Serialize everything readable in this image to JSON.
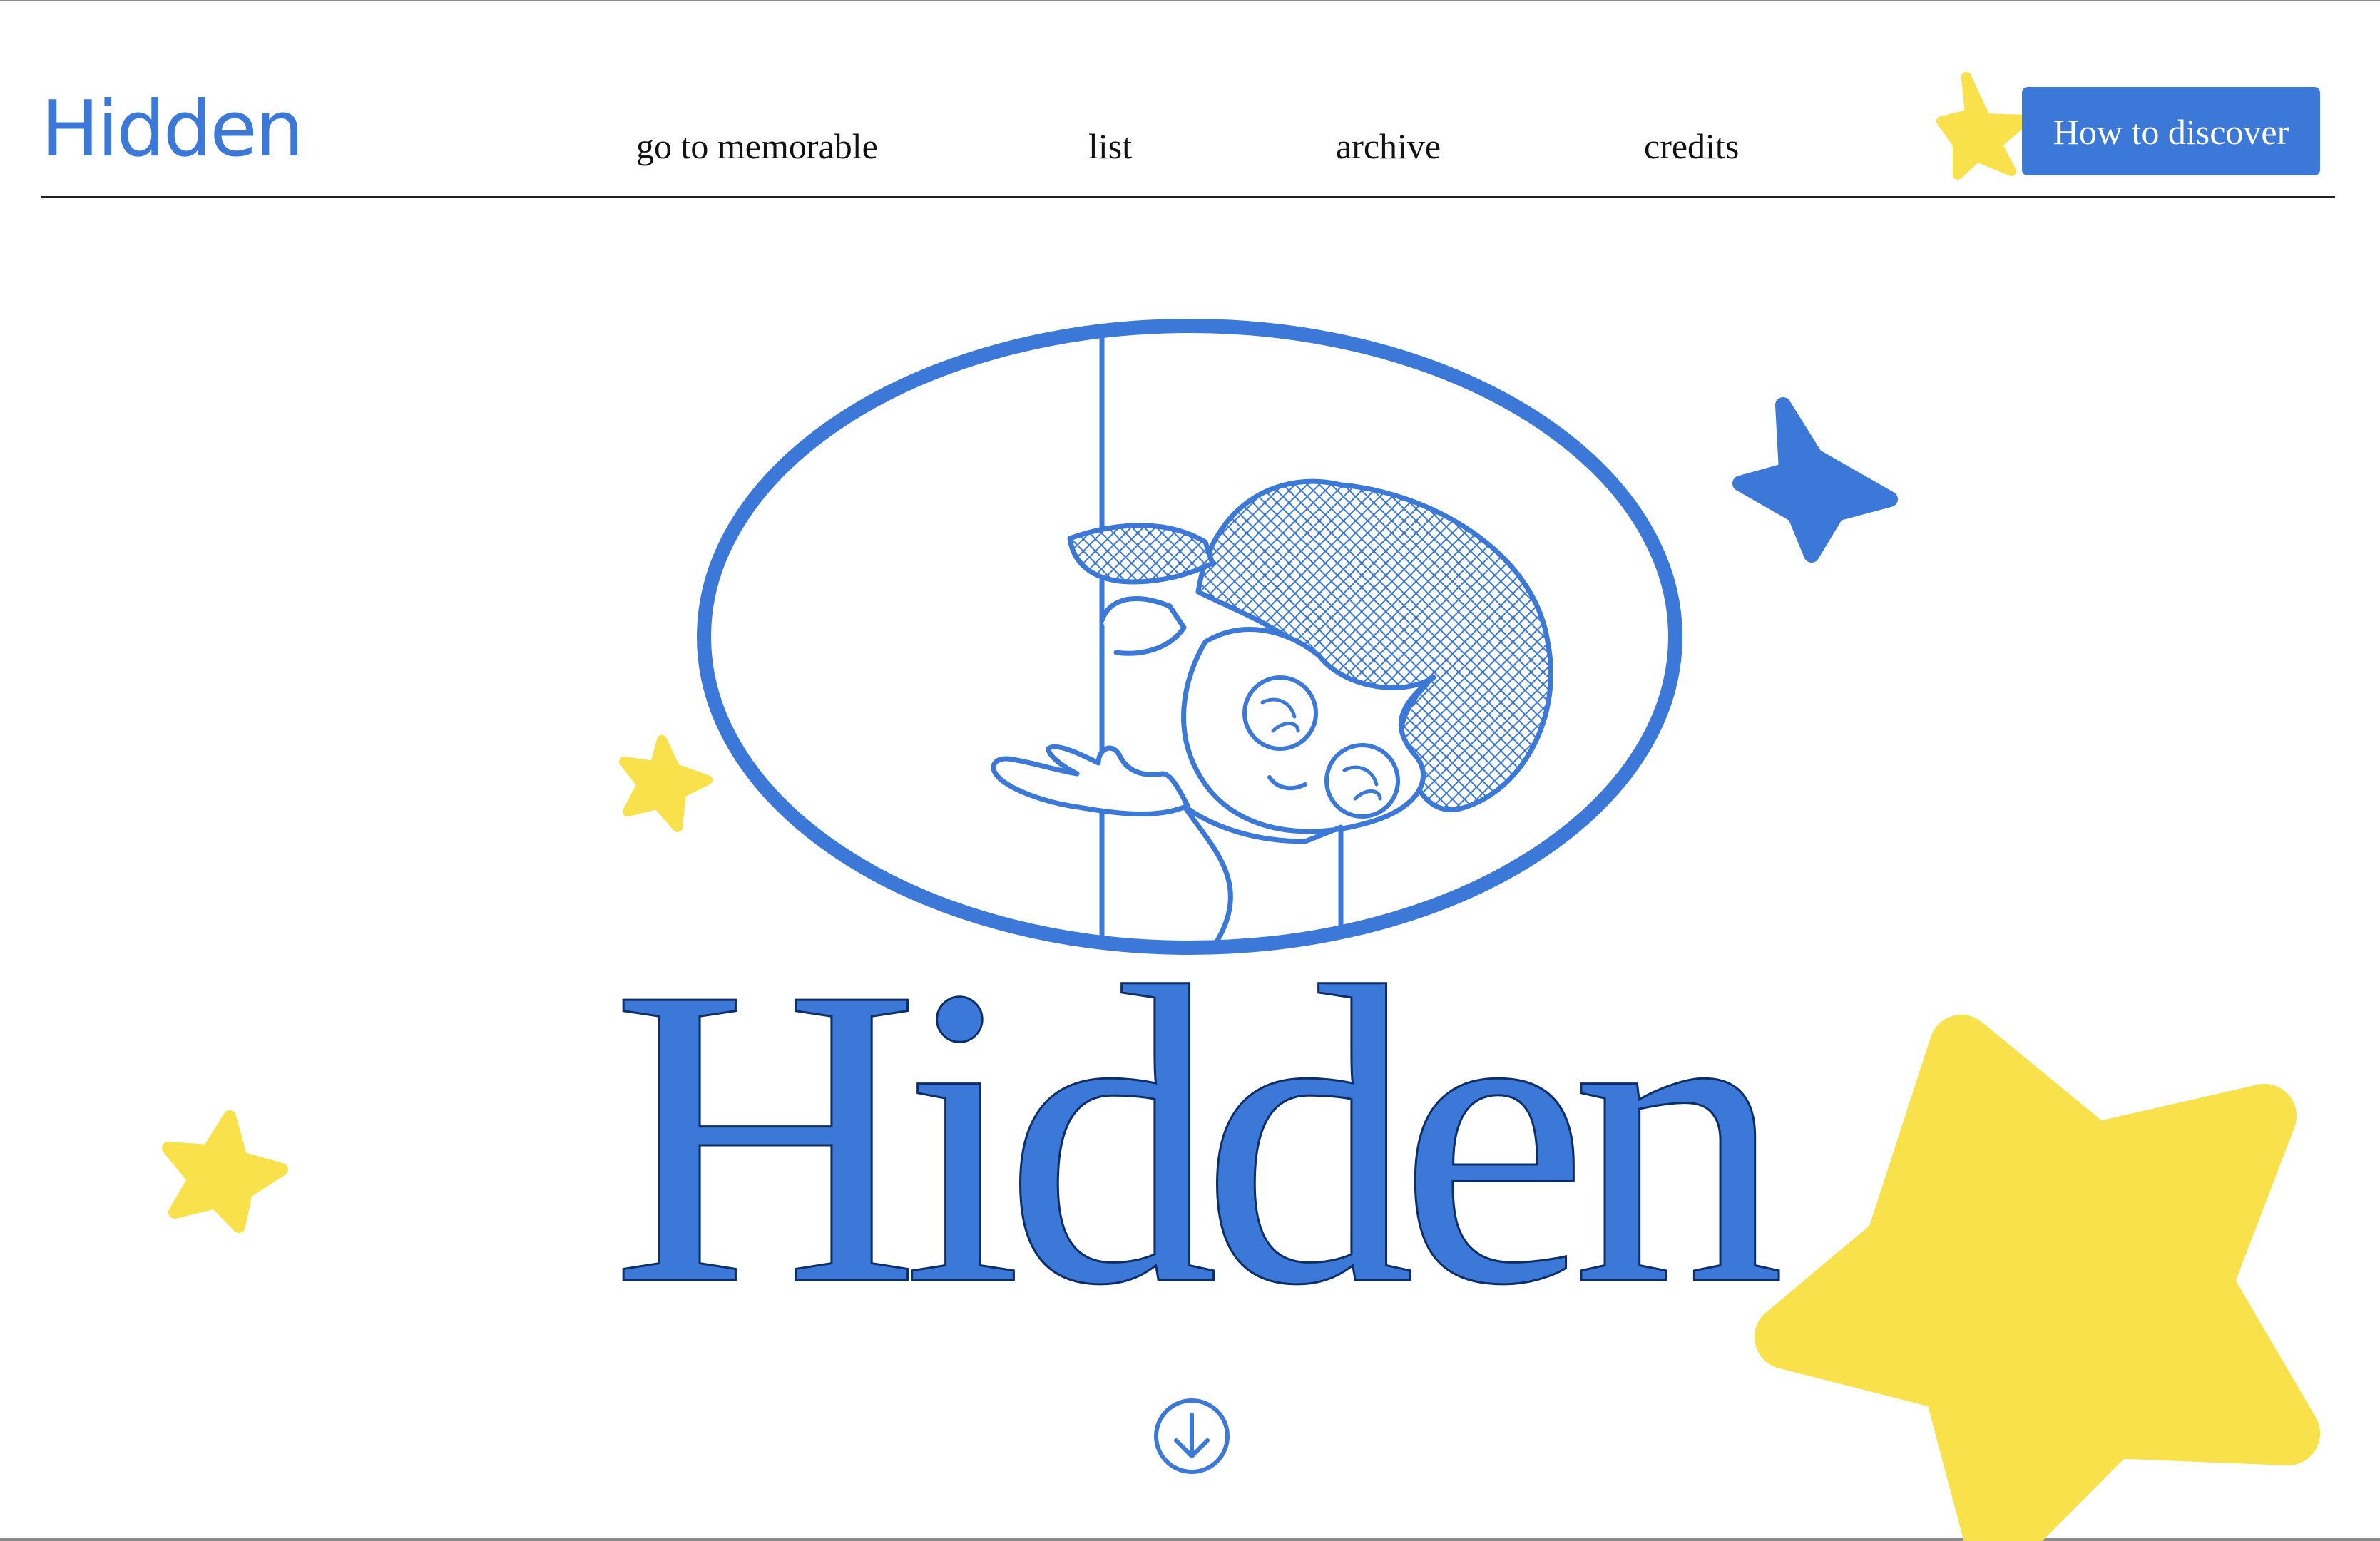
{
  "header": {
    "logo": "Hidden",
    "nav": [
      {
        "label": "go to memorable"
      },
      {
        "label": "list"
      },
      {
        "label": "archive"
      },
      {
        "label": "credits"
      }
    ],
    "cta_label": "How to discover"
  },
  "hero": {
    "title": "Hidden",
    "illustration": "child-peeking-through-oval-window",
    "scroll_icon": "arrow-down-circle-icon"
  },
  "colors": {
    "brand_blue": "#3b78d8",
    "star_yellow": "#f9e14b",
    "text_dark": "#111111"
  }
}
